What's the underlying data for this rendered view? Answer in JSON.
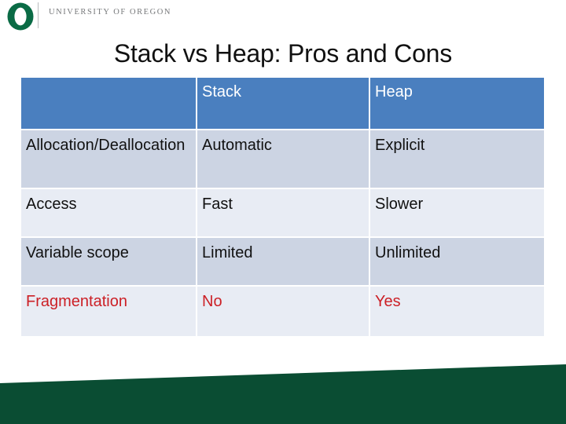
{
  "brand": {
    "logo_icon": "uo-o-logo-icon",
    "logo_color": "#0a6b45",
    "name": "UNIVERSITY OF OREGON",
    "name_color": "#77797b"
  },
  "slide": {
    "title": "Stack vs Heap: Pros and Cons"
  },
  "table": {
    "header_bg": "#4a7fbf",
    "header_text_color": "#ffffff",
    "band_dark": "#ccd4e3",
    "band_light": "#e8ecf4",
    "alert_color": "#cc2026",
    "columns": [
      "",
      "Stack",
      "Heap"
    ],
    "rows": [
      {
        "feature": "Allocation/Deallocation",
        "stack": "Automatic",
        "heap": "Explicit",
        "alert": false
      },
      {
        "feature": "Access",
        "stack": "Fast",
        "heap": "Slower",
        "alert": false
      },
      {
        "feature": "Variable scope",
        "stack": "Limited",
        "heap": "Unlimited",
        "alert": false
      },
      {
        "feature": "Fragmentation",
        "stack": "No",
        "heap": "Yes",
        "alert": true
      }
    ]
  },
  "footer": {
    "band_color": "#0a4d33"
  }
}
